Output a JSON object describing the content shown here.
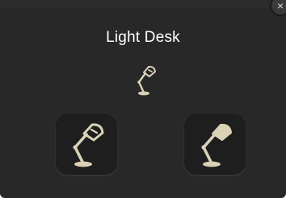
{
  "widget": {
    "title": "Light Desk",
    "status_icon": "desk-lamp-off-icon",
    "buttons": [
      {
        "icon": "desk-lamp-off-icon",
        "state": "off"
      },
      {
        "icon": "desk-lamp-on-icon",
        "state": "on"
      }
    ],
    "close_icon": "close-icon",
    "close_glyph": "×"
  },
  "colors": {
    "panel_bg": "#282828",
    "button_bg": "#1e1e1e",
    "lamp_color": "#d9d2b5",
    "title_color": "#ffffff"
  }
}
